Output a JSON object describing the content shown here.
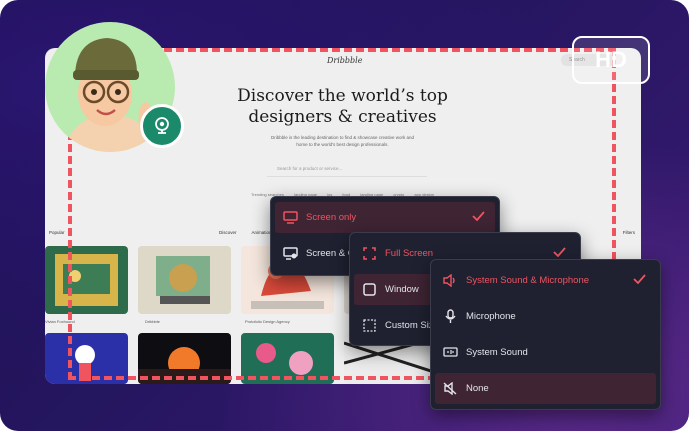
{
  "website": {
    "logo": "Dribbble",
    "search_placeholder": "Search",
    "headline_line1": "Discover the world’s top",
    "headline_line2": "designers & creatives",
    "subtitle_line1": "Dribbble is the leading destination to find & showcase creative work and",
    "subtitle_line2": "home to the world's best design professionals.",
    "search_bar_placeholder": "Search for a product or service...",
    "trending_label": "Trending searches",
    "trending": [
      "landing page",
      "ios",
      "food",
      "landing page",
      "crypto",
      "app design"
    ],
    "filter_left": "Popular",
    "filters": [
      "Discover",
      "Animation"
    ],
    "filter_right": "Filters",
    "captions": [
      "Vivian Foxhound",
      "Dribbble",
      "Protofolio Design Agency"
    ]
  },
  "hd_badge": "HD",
  "menu_capture": {
    "items": [
      {
        "label": "Screen only",
        "icon": "monitor-icon",
        "selected": true,
        "active": true,
        "checked": true
      },
      {
        "label": "Screen & Camera",
        "icon": "monitor-camera-icon",
        "selected": false,
        "active": false,
        "checked": false
      }
    ]
  },
  "menu_area": {
    "items": [
      {
        "label": "Full Screen",
        "icon": "fullscreen-icon",
        "selected": false,
        "active": true,
        "checked": true
      },
      {
        "label": "Window",
        "icon": "window-icon",
        "selected": true,
        "active": false,
        "checked": false
      },
      {
        "label": "Custom Size",
        "icon": "custom-size-icon",
        "selected": false,
        "active": false,
        "checked": false
      }
    ]
  },
  "menu_audio": {
    "items": [
      {
        "label": "System Sound & Microphone",
        "icon": "speaker-icon",
        "selected": false,
        "active": true,
        "checked": true
      },
      {
        "label": "Microphone",
        "icon": "microphone-icon",
        "selected": false,
        "active": false,
        "checked": false
      },
      {
        "label": "System Sound",
        "icon": "system-sound-icon",
        "selected": false,
        "active": false,
        "checked": false
      },
      {
        "label": "None",
        "icon": "mute-icon",
        "selected": true,
        "active": false,
        "checked": false
      }
    ]
  },
  "colors": {
    "accent": "#f0545f",
    "menu_bg": "#1f2131",
    "selected_bg": "#3f2433",
    "cam_bg": "#1b8a6a"
  }
}
